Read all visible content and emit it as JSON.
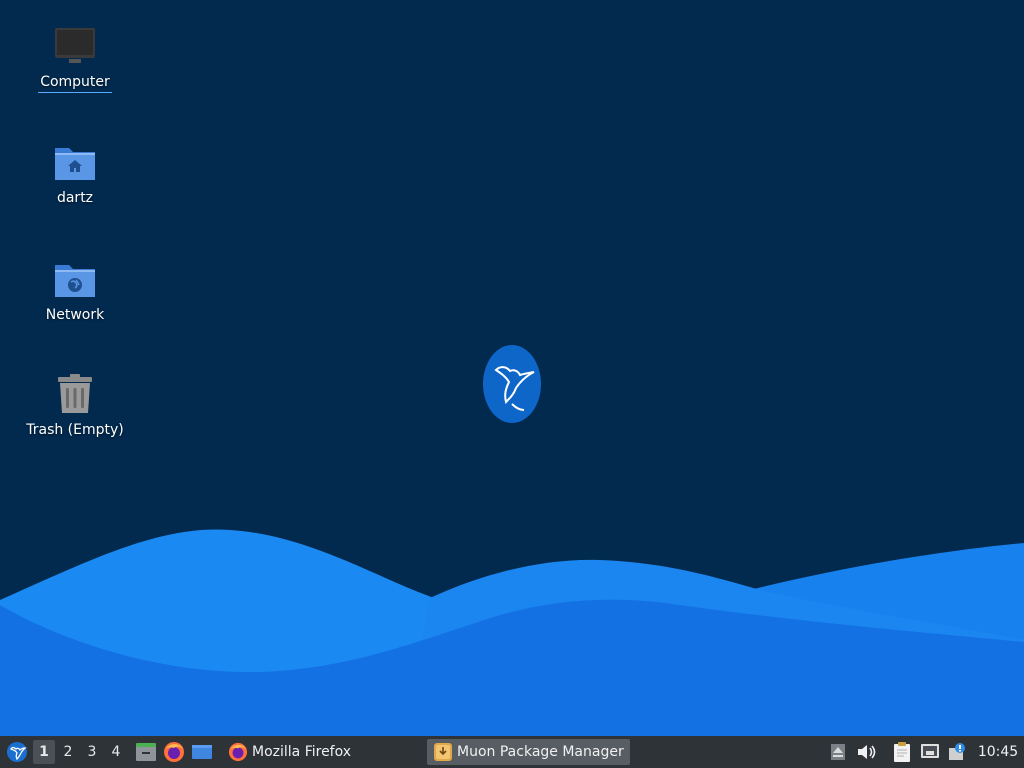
{
  "desktop": {
    "icons": [
      {
        "label": "Computer",
        "icon": "computer-icon"
      },
      {
        "label": "dartz",
        "icon": "home-folder-icon"
      },
      {
        "label": "Network",
        "icon": "network-folder-icon"
      },
      {
        "label": "Trash (Empty)",
        "icon": "trash-icon"
      }
    ],
    "wallpaper": {
      "background": "#022a4f",
      "wave_light": "#1e8ff5",
      "wave_dark": "#1373e6",
      "logo": "hummingbird-logo"
    }
  },
  "taskbar": {
    "start_icon": "lubuntu-start-icon",
    "workspaces": [
      "1",
      "2",
      "3",
      "4"
    ],
    "active_workspace": "1",
    "launchers": [
      "file-manager-icon",
      "firefox-icon",
      "show-desktop-icon"
    ],
    "tasks": [
      {
        "label": "Mozilla Firefox",
        "icon": "firefox-icon",
        "active": false
      },
      {
        "label": "Muon Package Manager",
        "icon": "package-manager-icon",
        "active": true
      }
    ],
    "tray": [
      "eject-icon",
      "volume-icon",
      "clipboard-icon",
      "network-wired-icon",
      "update-notifier-icon"
    ],
    "clock": "10:45"
  }
}
